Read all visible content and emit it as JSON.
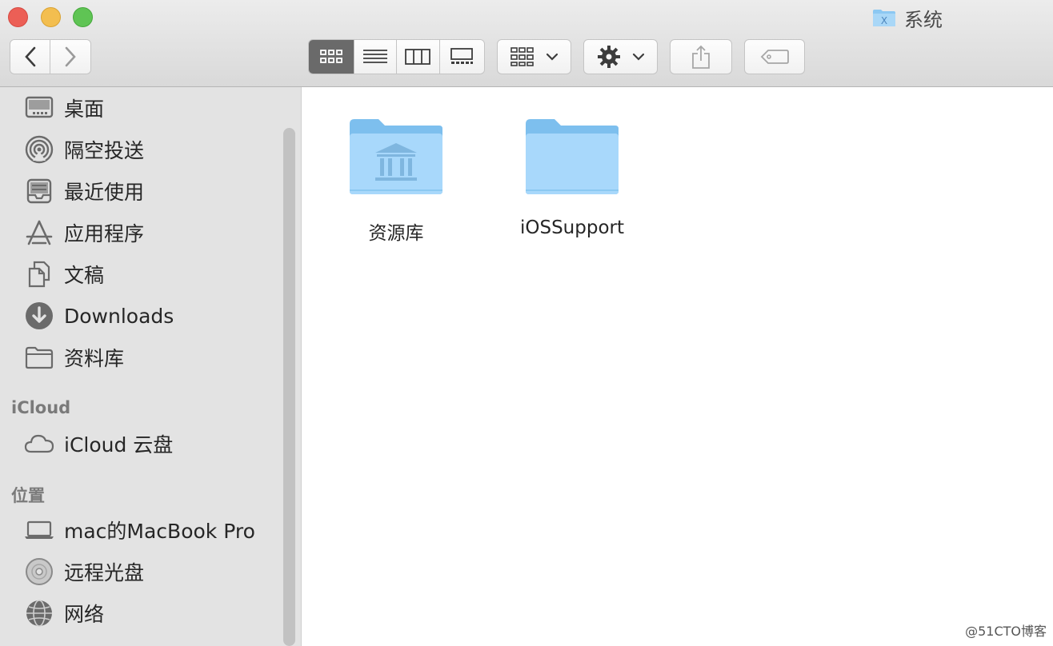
{
  "window": {
    "title": "系统",
    "title_icon": "xcode-folder-icon"
  },
  "toolbar": {
    "back": "chevron-left-icon",
    "forward": "chevron-right-icon",
    "view_modes": [
      "icon-view",
      "list-view",
      "column-view",
      "gallery-view"
    ],
    "active_view": "icon-view",
    "group_menu": "group-by-icon",
    "action_menu": "gear-icon",
    "share": "share-icon",
    "tags": "tag-icon"
  },
  "sidebar": {
    "favorites": [
      {
        "label": "桌面",
        "icon": "desktop-icon"
      },
      {
        "label": "隔空投送",
        "icon": "airdrop-icon"
      },
      {
        "label": "最近使用",
        "icon": "recents-icon"
      },
      {
        "label": "应用程序",
        "icon": "applications-icon"
      },
      {
        "label": "文稿",
        "icon": "documents-icon"
      },
      {
        "label": "Downloads",
        "icon": "downloads-icon"
      },
      {
        "label": "资料库",
        "icon": "folder-icon"
      }
    ],
    "icloud_header": "iCloud",
    "icloud": [
      {
        "label": "iCloud 云盘",
        "icon": "cloud-icon"
      }
    ],
    "locations_header": "位置",
    "locations": [
      {
        "label": "mac的MacBook Pro",
        "icon": "laptop-icon"
      },
      {
        "label": "远程光盘",
        "icon": "disc-icon"
      },
      {
        "label": "网络",
        "icon": "network-icon"
      }
    ]
  },
  "content": {
    "items": [
      {
        "name": "资源库",
        "icon": "library-folder-icon"
      },
      {
        "name": "iOSSupport",
        "icon": "folder-icon"
      }
    ]
  },
  "watermark": "@51CTO博客",
  "colors": {
    "folder_light": "#a8d8fb",
    "folder_dark": "#7dbfee",
    "sidebar_bg": "#e3e3e3",
    "active_segment": "#6a6a6a"
  }
}
